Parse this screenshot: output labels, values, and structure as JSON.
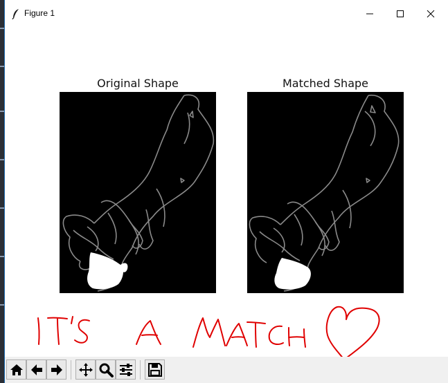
{
  "window": {
    "title": "Figure 1",
    "icons": {
      "app": "feather-icon",
      "minimize": "minimize-icon",
      "maximize": "maximize-icon",
      "close": "close-icon"
    }
  },
  "figure": {
    "panels": [
      {
        "title": "Original Shape"
      },
      {
        "title": "Matched Shape"
      }
    ],
    "annotation": {
      "text": "IT'S A MATCH",
      "symbol": "heart",
      "color": "#e00000"
    }
  },
  "toolbar": {
    "buttons": [
      {
        "icon": "home-icon"
      },
      {
        "icon": "back-arrow-icon"
      },
      {
        "icon": "forward-arrow-icon"
      },
      {
        "icon": "pan-icon"
      },
      {
        "icon": "zoom-icon"
      },
      {
        "icon": "configure-subplots-icon"
      },
      {
        "icon": "save-icon"
      }
    ]
  }
}
